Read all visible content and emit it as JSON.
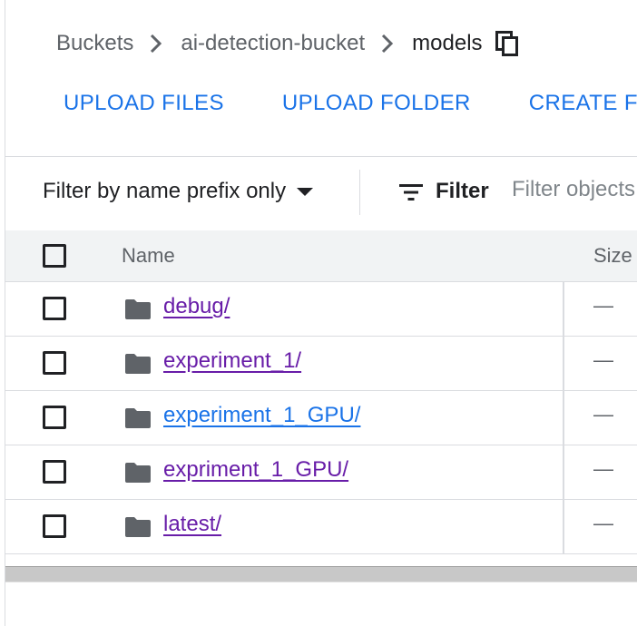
{
  "breadcrumb": {
    "items": [
      "Buckets",
      "ai-detection-bucket",
      "models"
    ],
    "copy_icon": "copy-icon"
  },
  "actions": [
    "UPLOAD FILES",
    "UPLOAD FOLDER",
    "CREATE FO"
  ],
  "filter": {
    "prefix_select": "Filter by name prefix only",
    "label": "Filter",
    "placeholder": "Filter objects"
  },
  "table": {
    "headers": {
      "name": "Name",
      "size": "Size"
    },
    "rows": [
      {
        "name": "debug/",
        "size": "—",
        "link_color": "#681da8"
      },
      {
        "name": "experiment_1/",
        "size": "—",
        "link_color": "#681da8"
      },
      {
        "name": "experiment_1_GPU/",
        "size": "—",
        "link_color": "#1a73e8"
      },
      {
        "name": "expriment_1_GPU/",
        "size": "—",
        "link_color": "#681da8"
      },
      {
        "name": "latest/",
        "size": "—",
        "link_color": "#681da8"
      }
    ]
  },
  "colors": {
    "accent": "#1a73e8",
    "visited": "#681da8",
    "text": "#202124",
    "muted": "#5f6368"
  }
}
